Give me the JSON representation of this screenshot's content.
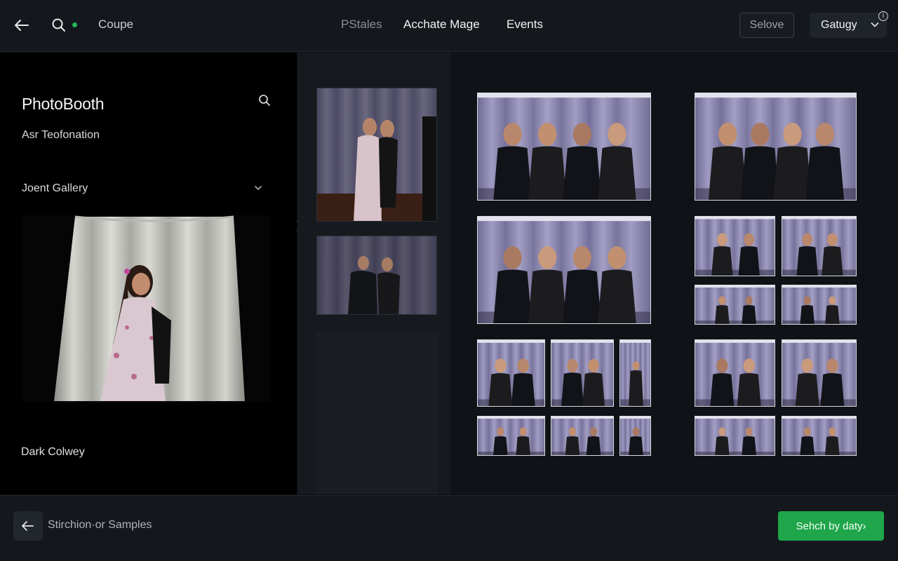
{
  "topbar": {
    "title": "Coupe",
    "nav": [
      "PStales",
      "Acchate Mage",
      "Events"
    ],
    "select_label": "Selove",
    "category_label": "Gatugy"
  },
  "left_panel": {
    "title": "PhotoBooth",
    "subtitle": "Asr Teofonation",
    "gallery_label": "Joent Gallery",
    "footer_label": "Dark Colwey"
  },
  "bottom": {
    "back_label": "Stirchion·or Samples",
    "action_label": "Sehch by daty›"
  },
  "colors": {
    "accent_green": "#1fa64b",
    "status_dot": "#22b455",
    "curtain_purple": "#8a86ad"
  }
}
